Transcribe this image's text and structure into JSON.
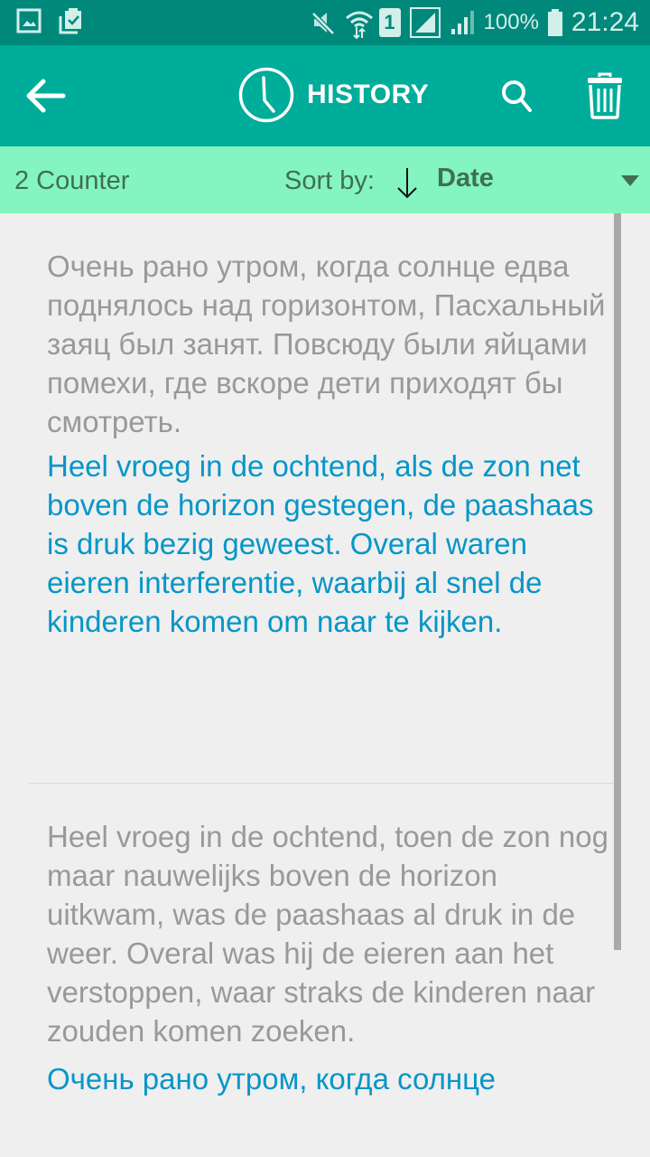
{
  "status_bar": {
    "left_icons": [
      "gallery-notification-icon",
      "clipboard-check-icon"
    ],
    "right_icons": [
      "mute-icon",
      "wifi-icon",
      "sim1-icon",
      "signal-icon",
      "signal-icon-2",
      "battery-icon"
    ],
    "sim_label": "1",
    "battery": "100%",
    "time": "21:24"
  },
  "app_bar": {
    "title": "HISTORY",
    "back_icon": "arrow-left-icon",
    "title_icon": "clock-icon",
    "search_icon": "search-icon",
    "delete_icon": "trash-icon"
  },
  "sort_bar": {
    "counter": "2 Counter",
    "sort_label": "Sort by:",
    "sort_direction": "descending",
    "sort_value": "Date"
  },
  "history": [
    {
      "source": "Очень рано утром, когда солнце едва поднялось над горизонтом, Пасхальный заяц был занят. Повсюду были яйцами помехи, где вскоре дети приходят бы смотреть.",
      "translation": "Heel vroeg in de ochtend, als de zon net boven de horizon gestegen, de paashaas is druk bezig geweest. Overal waren eieren interferentie, waarbij al snel de kinderen komen om naar te kijken."
    },
    {
      "source": "Heel vroeg in de ochtend, toen de zon nog maar nauwelijks boven de horizon uitkwam, was de paashaas al druk in de weer. Overal was hij de eieren aan het verstoppen, waar straks de kinderen naar zouden komen zoeken.",
      "translation": "Очень рано утром, когда солнце"
    }
  ],
  "colors": {
    "status_bar": "#00897b",
    "app_bar": "#00ac9a",
    "sort_bar": "#84f5c0",
    "source_text": "#999999",
    "translation_text": "#0696c7",
    "background": "#efefef"
  }
}
